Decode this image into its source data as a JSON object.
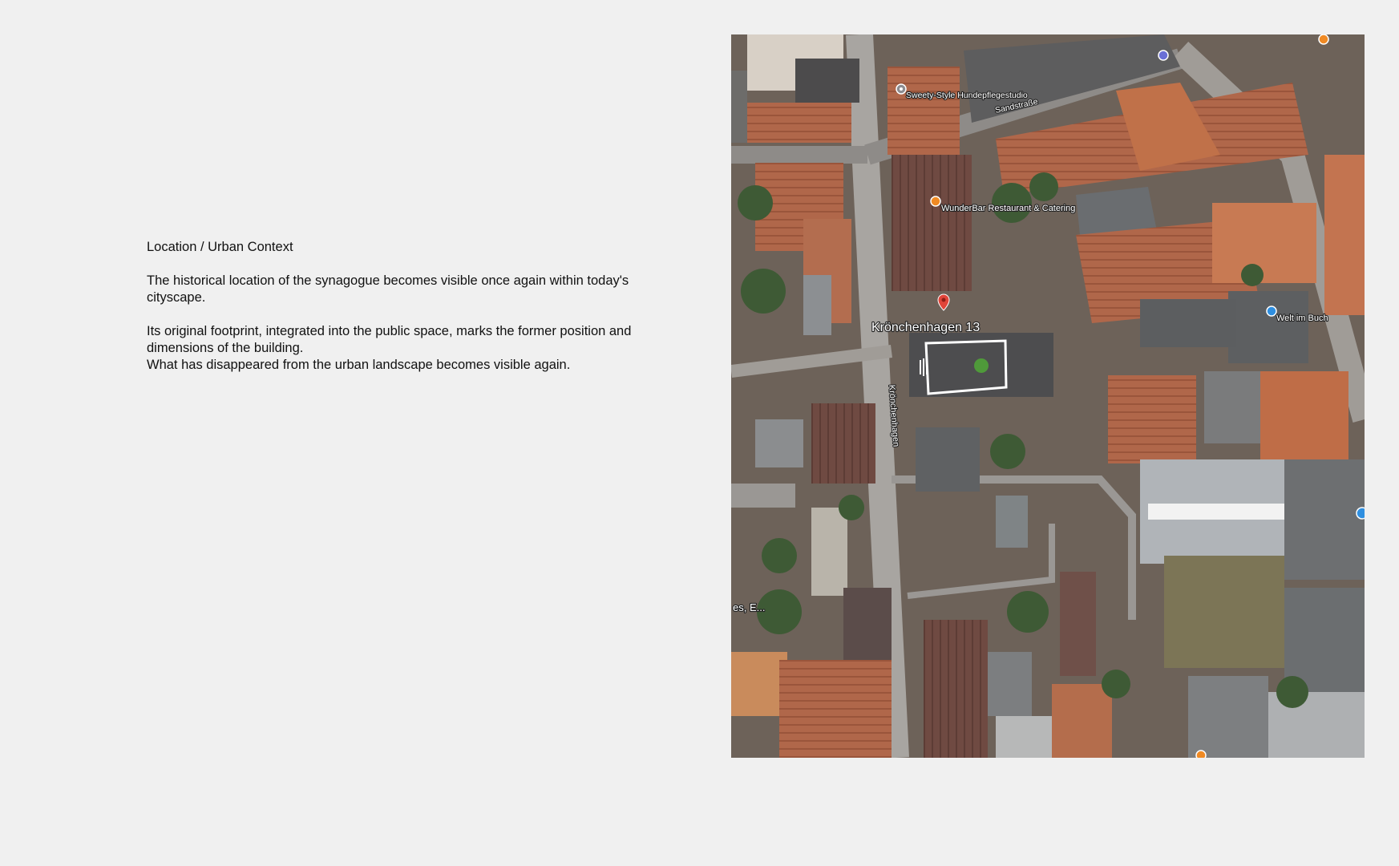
{
  "text": {
    "title": "Location / Urban Context",
    "paragraph1": "The historical location of the synagogue becomes visible once again within today's cityscape.",
    "paragraph2_line1": "Its original footprint, integrated into the public space, marks the former position and dimensions of the building.",
    "paragraph2_line2": "What has disappeared from the urban landscape becomes visible again."
  },
  "map": {
    "labels": {
      "poi_groomer": "Sweety-Style Hundepflegestudio",
      "street_top": "Sandstraße",
      "poi_restaurant": "WunderBar Restaurant & Catering",
      "address": "Krönchenhagen 13",
      "street_vertical": "Krönchenhagen",
      "poi_bookshop": "Welt im Buch",
      "edge_truncated": "es, E..."
    },
    "icons": {
      "groomer": "grey-poi-pin",
      "restaurant": "orange-poi-pin",
      "address": "red-location-pin",
      "bookshop": "blue-poi-pin"
    },
    "colors": {
      "site_fill": "#4d4d4f",
      "footprint_outline": "#ffffff",
      "center_dot": "#4f9a3a",
      "pin_red": "#e0453a",
      "pin_orange": "#f08a24",
      "pin_blue": "#2f8fe0"
    }
  }
}
